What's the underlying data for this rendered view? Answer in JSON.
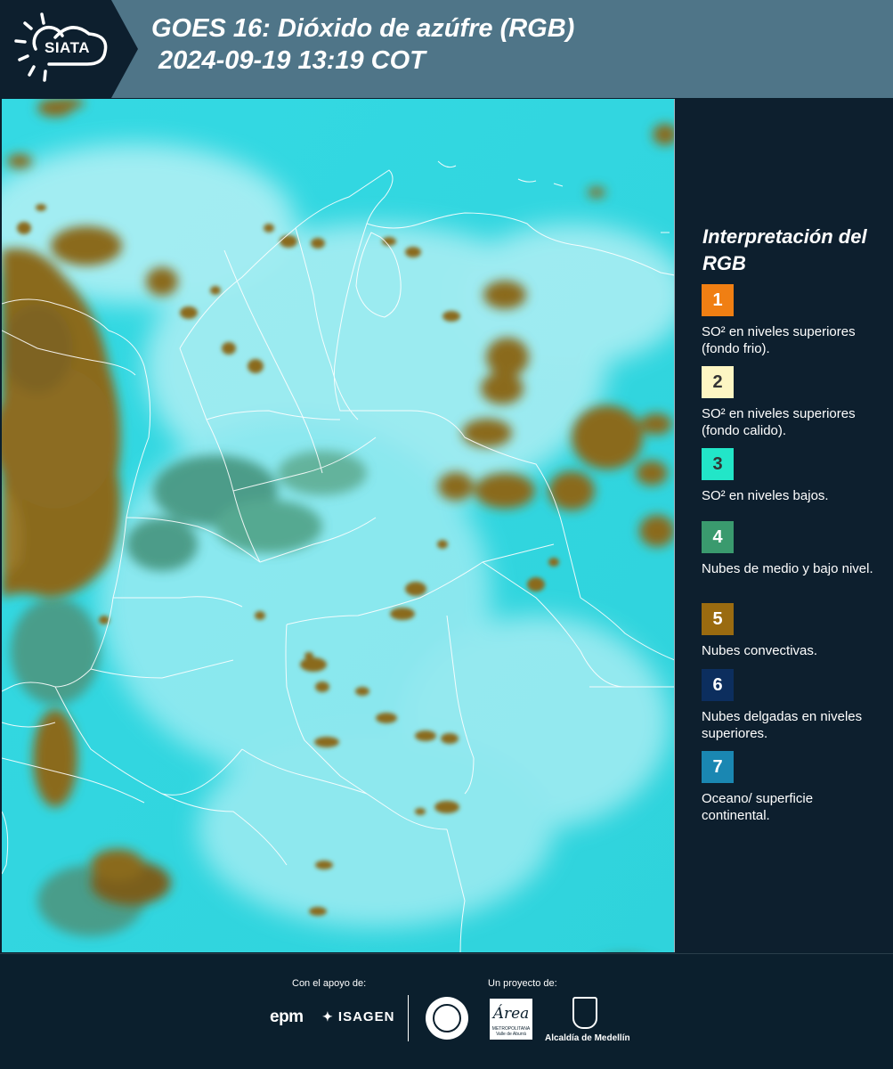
{
  "header": {
    "logo_text": "SIATA",
    "title_line1": "GOES 16: Dióxido de azúfre (RGB)",
    "title_line2": " 2024-09-19 13:19 COT"
  },
  "legend": {
    "title": "Interpretación del RGB",
    "items": [
      {
        "num": "1",
        "color": "#f07f13",
        "num_color": "#ffffff",
        "text": "SO² en niveles superiores (fondo frio)."
      },
      {
        "num": "2",
        "color": "#fdf6c3",
        "num_color": "#333333",
        "text": "SO² en niveles superiores (fondo calido)."
      },
      {
        "num": "3",
        "color": "#22e6c8",
        "num_color": "#333333",
        "text": "SO² en niveles bajos."
      },
      {
        "num": "4",
        "color": "#3a9a6e",
        "num_color": "#ffffff",
        "text": "Nubes de medio y bajo nivel."
      },
      {
        "num": "5",
        "color": "#9a6b10",
        "num_color": "#ffffff",
        "text": "Nubes convectivas."
      },
      {
        "num": "6",
        "color": "#0c2e5e",
        "num_color": "#ffffff",
        "text": "Nubes delgadas en niveles superiores."
      },
      {
        "num": "7",
        "color": "#1a87b2",
        "num_color": "#ffffff",
        "text": "Oceano/ superficie continental."
      }
    ]
  },
  "footer": {
    "support_label": "Con el apoyo de:",
    "project_label": "Un proyecto de:",
    "epm": "epm",
    "isagen": "ISAGEN",
    "area_name": "Área",
    "area_sub": "METROPOLITANA Valle de Aburrá",
    "alcaldia": "Alcaldía de Medellín"
  },
  "colors": {
    "header_bg": "#4f7588",
    "logo_bg": "#0d1f2e",
    "ocean": "#35d8e0",
    "cloud_white": "#d8f5f8",
    "convective": "#8a6a1c",
    "midlevel": "#3c8a70"
  }
}
